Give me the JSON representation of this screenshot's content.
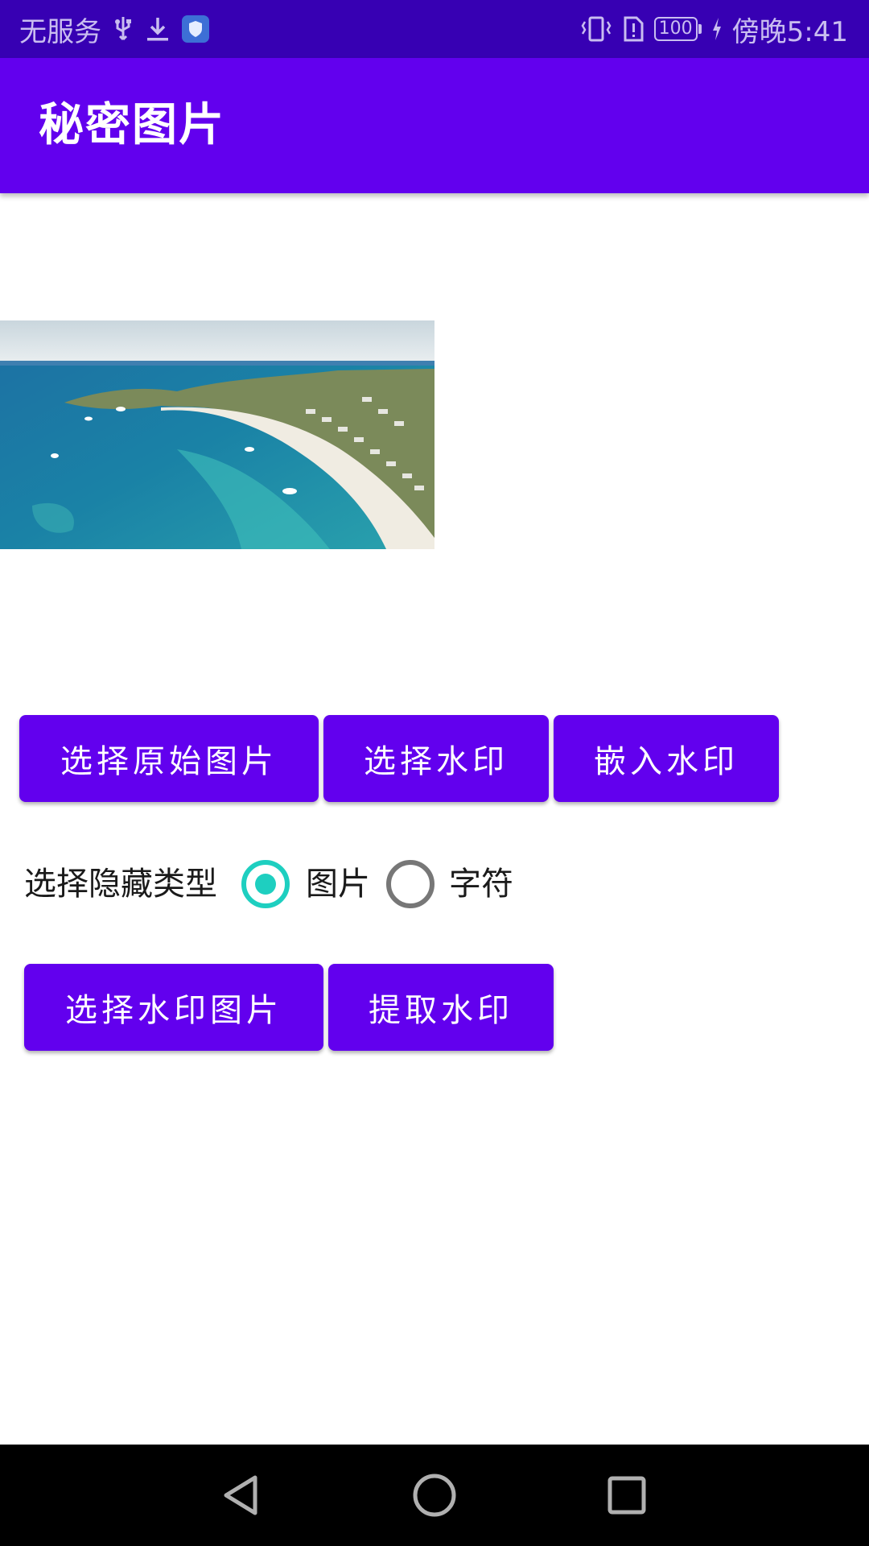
{
  "status_bar": {
    "carrier": "无服务",
    "battery": "100",
    "time": "傍晚5:41"
  },
  "app_bar": {
    "title": "秘密图片"
  },
  "buttons": {
    "select_original": "选择原始图片",
    "select_watermark": "选择水印",
    "embed_watermark": "嵌入水印",
    "select_watermark_image": "选择水印图片",
    "extract_watermark": "提取水印"
  },
  "hide_type": {
    "label": "选择隐藏类型",
    "options": [
      {
        "label": "图片",
        "selected": true
      },
      {
        "label": "字符",
        "selected": false
      }
    ]
  },
  "colors": {
    "status_bar": "#3700b3",
    "primary": "#6200ee",
    "radio_accent": "#1ecfc0"
  },
  "icons": [
    "usb-icon",
    "download-icon",
    "shield-icon",
    "vibrate-icon",
    "sim-alert-icon",
    "battery-icon",
    "charging-icon",
    "back-icon",
    "home-icon",
    "recents-icon"
  ]
}
